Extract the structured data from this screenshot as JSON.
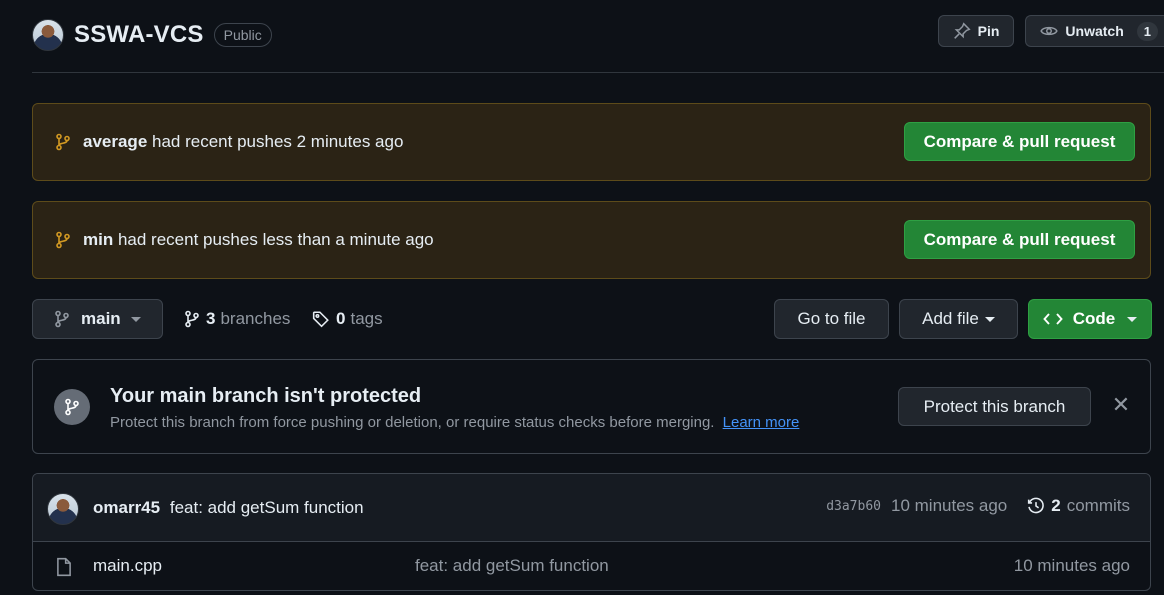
{
  "repo": {
    "name": "SSWA-VCS",
    "visibility": "Public",
    "pin_label": "Pin",
    "unwatch_label": "Unwatch",
    "watch_count": "1"
  },
  "push_banners": [
    {
      "branch": "average",
      "text": "had recent pushes 2 minutes ago",
      "button": "Compare & pull request"
    },
    {
      "branch": "min",
      "text": "had recent pushes less than a minute ago",
      "button": "Compare & pull request"
    }
  ],
  "branch_bar": {
    "current_branch": "main",
    "branch_count": "3",
    "branches_label": "branches",
    "tag_count": "0",
    "tags_label": "tags",
    "go_to_file": "Go to file",
    "add_file": "Add file",
    "code": "Code"
  },
  "protection": {
    "title": "Your main branch isn't protected",
    "description": "Protect this branch from force pushing or deletion, or require status checks before merging.",
    "learn_more": "Learn more",
    "button": "Protect this branch",
    "close": "✕"
  },
  "latest_commit": {
    "author": "omarr45",
    "message": "feat: add getSum function",
    "sha": "d3a7b60",
    "time": "10 minutes ago",
    "commit_count": "2",
    "commits_label": "commits"
  },
  "files": [
    {
      "name": "main.cpp",
      "message": "feat: add getSum function",
      "time": "10 minutes ago"
    }
  ],
  "colors": {
    "background": "#0d1117",
    "green_button": "#238636",
    "banner_bg": "#2b2315",
    "branch_icon": "#d29922",
    "link": "#4493f8"
  },
  "icons": [
    "pin-icon",
    "eye-icon",
    "git-branch-icon",
    "tag-icon",
    "code-icon",
    "history-icon",
    "file-icon",
    "close-icon"
  ]
}
